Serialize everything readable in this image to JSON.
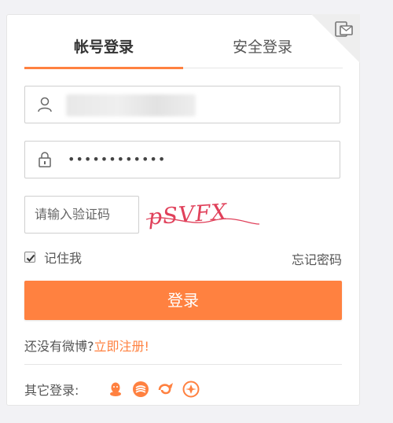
{
  "tabs": {
    "account_login": "帐号登录",
    "secure_login": "安全登录"
  },
  "username": {
    "value": ""
  },
  "password": {
    "value": "••••••••••••"
  },
  "captcha": {
    "placeholder": "请输入验证码",
    "image_text": "pSVFX"
  },
  "remember": {
    "label": "记住我",
    "checked": true
  },
  "forgot_label": "忘记密码",
  "login_button": "登录",
  "signup": {
    "prompt": "还没有微博?",
    "link": "立即注册!"
  },
  "other_login": {
    "label": "其它登录:",
    "icons": [
      "qq-icon",
      "sina-icon",
      "wechat-icon",
      "other-icon"
    ]
  },
  "colors": {
    "accent": "#ff8140",
    "border": "#cfcfcf",
    "captcha": "#e0405a"
  }
}
